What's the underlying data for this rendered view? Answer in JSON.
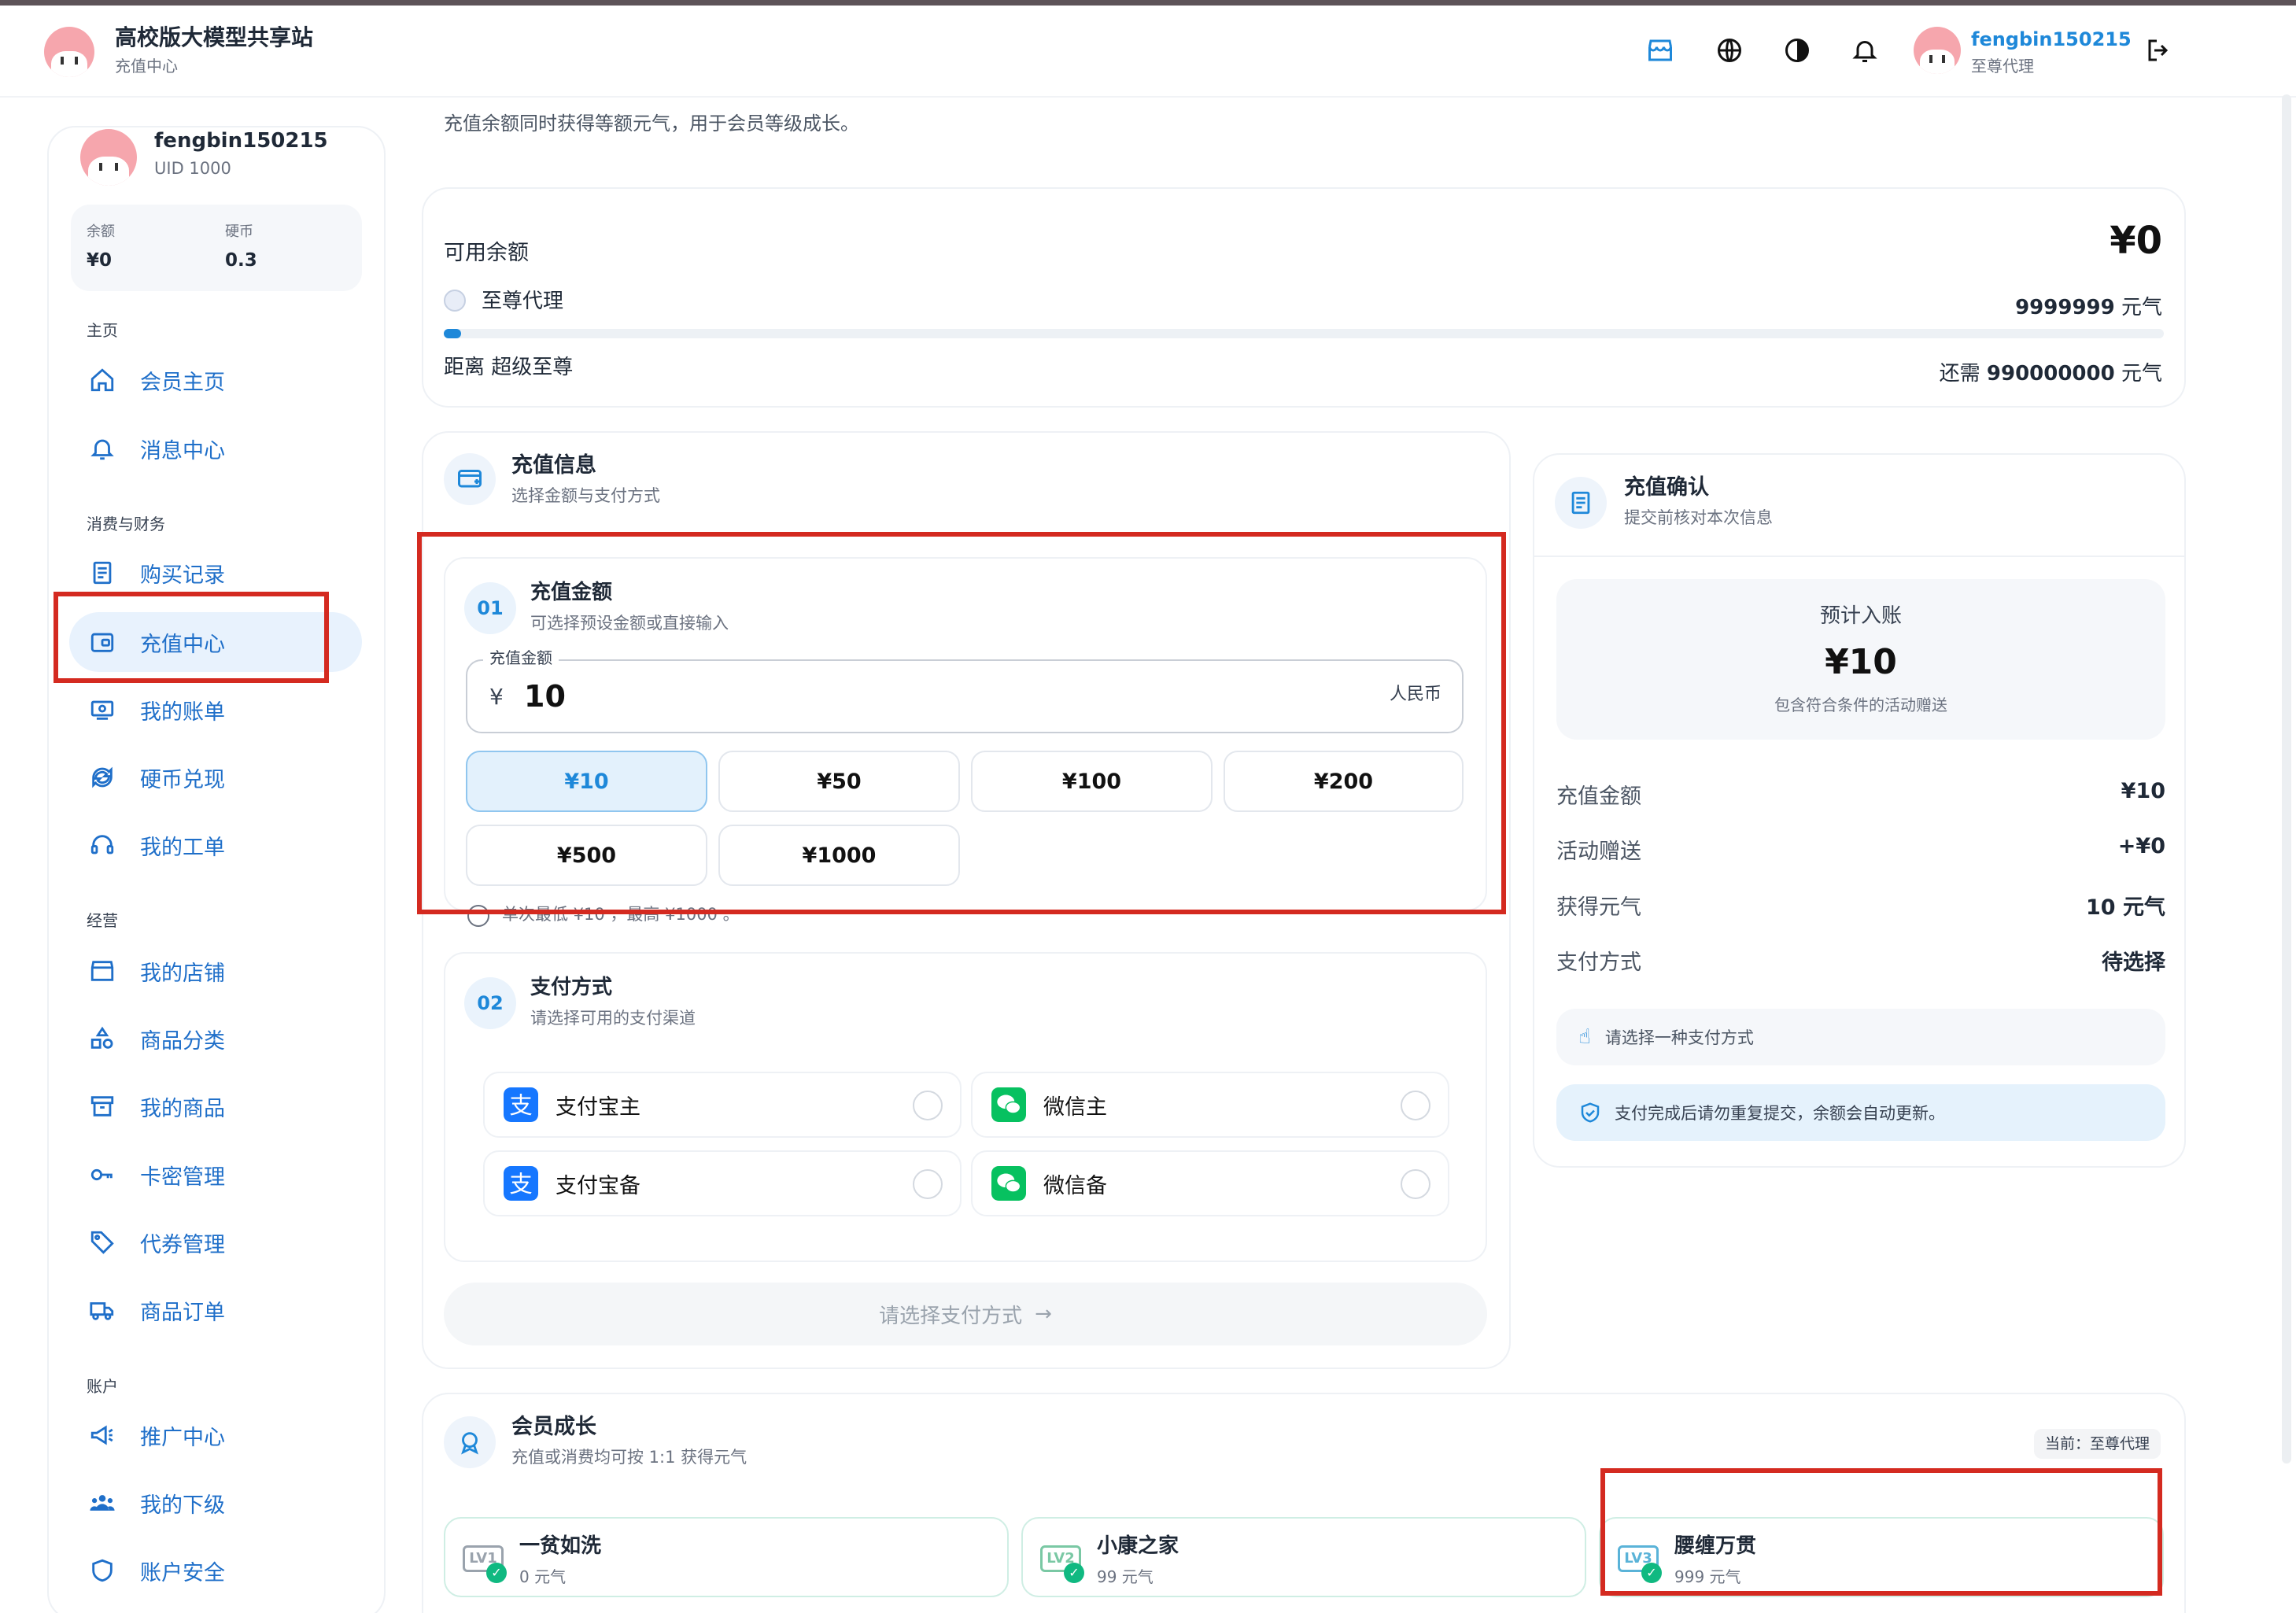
{
  "header": {
    "site_title": "高校版大模型共享站",
    "page_subtitle": "充值中心",
    "username": "fengbin150215",
    "user_role": "至尊代理"
  },
  "sidebar": {
    "username": "fengbin150215",
    "uid": "UID 1000",
    "balance_label": "余额",
    "balance_value": "¥0",
    "coin_label": "硬币",
    "coin_value": "0.3",
    "sections": {
      "home": "主页",
      "finance": "消费与财务",
      "business": "经营",
      "account": "账户"
    },
    "items": [
      "会员主页",
      "消息中心",
      "购买记录",
      "充值中心",
      "我的账单",
      "硬币兑现",
      "我的工单",
      "我的店铺",
      "商品分类",
      "我的商品",
      "卡密管理",
      "代券管理",
      "商品订单",
      "推广中心",
      "我的下级",
      "账户安全"
    ]
  },
  "intro": {
    "text": "充值余额同时获得等额元气，用于会员等级成长。"
  },
  "balance_card": {
    "label": "可用余额",
    "amount": "¥0",
    "level": "至尊代理",
    "points": "9999999",
    "points_unit": "元气",
    "progress": 0.008,
    "next_label": "距离 超级至尊",
    "need_prefix": "还需",
    "need_value": "990000000",
    "need_unit": "元气"
  },
  "recharge": {
    "title": "充值信息",
    "subtitle": "选择金额与支付方式",
    "step1_num": "01",
    "step1_title": "充值金额",
    "step1_sub": "可选择预设金额或直接输入",
    "field_label": "充值金额",
    "currency_symbol": "¥",
    "amount": "10",
    "currency": "人民币",
    "options": [
      "¥10",
      "¥50",
      "¥100",
      "¥200",
      "¥500",
      "¥1000"
    ],
    "selected": "¥10",
    "hint": "单次最低 ¥10 ，最高 ¥1000 。",
    "step2_num": "02",
    "step2_title": "支付方式",
    "step2_sub": "请选择可用的支付渠道",
    "methods": [
      "支付宝主",
      "微信主",
      "支付宝备",
      "微信备"
    ],
    "submit_label": "请选择支付方式"
  },
  "confirm": {
    "title": "充值确认",
    "subtitle": "提交前核对本次信息",
    "expect_label": "预计入账",
    "expect_amount": "¥10",
    "expect_note": "包含符合条件的活动赠送",
    "rows": [
      {
        "label": "充值金额",
        "value": "¥10"
      },
      {
        "label": "活动赠送",
        "value": "+¥0"
      },
      {
        "label": "获得元气",
        "value": "10 元气"
      },
      {
        "label": "支付方式",
        "value": "待选择"
      }
    ],
    "tip_select": "请选择一种支付方式",
    "tip_info": "支付完成后请勿重复提交，余额会自动更新。"
  },
  "growth": {
    "title": "会员成长",
    "subtitle": "充值或消费均可按 1:1 获得元气",
    "current": "当前：至尊代理",
    "tiers": [
      {
        "name": "一贫如洗",
        "req": "0 元气",
        "badge": "LV1"
      },
      {
        "name": "小康之家",
        "req": "99 元气",
        "badge": "LV2"
      },
      {
        "name": "腰缠万贯",
        "req": "999 元气",
        "badge": "LV3"
      }
    ]
  },
  "colors": {
    "accent": "#1e88d9",
    "nav": "#1f6fc9",
    "highlight": "#d42a20",
    "alipay": "#1677ff",
    "wechat": "#07c160"
  }
}
